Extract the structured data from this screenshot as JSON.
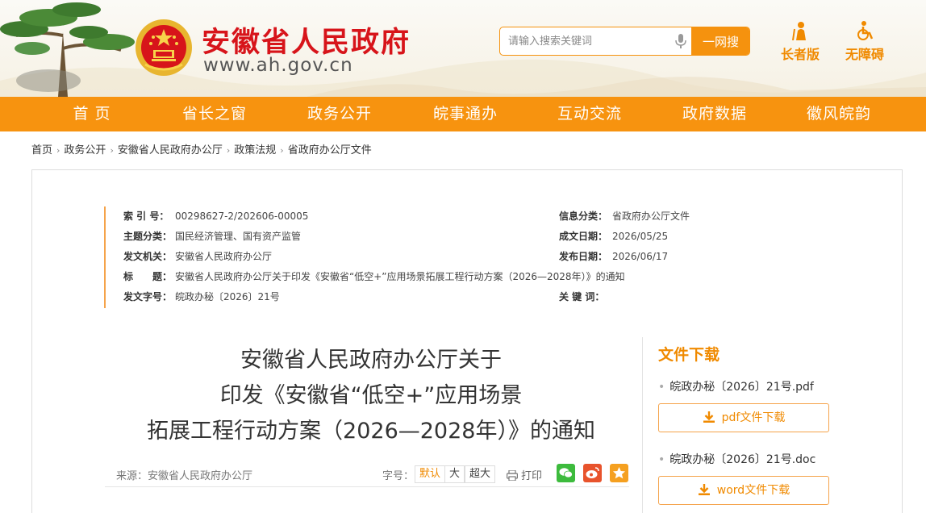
{
  "header": {
    "site_title": "安徽省人民政府",
    "site_url": "www.ah.gov.cn",
    "search": {
      "placeholder": "请输入搜索关键词",
      "button_label": "一网搜"
    },
    "tools": [
      {
        "label": "长者版",
        "icon": "elder-icon"
      },
      {
        "label": "无障碍",
        "icon": "wheelchair-icon"
      }
    ],
    "colors": {
      "brand_red": "#d7141a",
      "accent_orange": "#f7930f"
    }
  },
  "nav": {
    "items": [
      {
        "label": "首 页"
      },
      {
        "label": "省长之窗"
      },
      {
        "label": "政务公开"
      },
      {
        "label": "皖事通办"
      },
      {
        "label": "互动交流"
      },
      {
        "label": "政府数据"
      },
      {
        "label": "徽风皖韵"
      }
    ]
  },
  "breadcrumb": {
    "items": [
      "首页",
      "政务公开",
      "安徽省人民政府办公厅",
      "政策法规",
      "省政府办公厅文件"
    ]
  },
  "meta": {
    "index_no": {
      "key": "索 引 号：",
      "value": "00298627-2/202606-00005"
    },
    "theme": {
      "key": "主题分类：",
      "value": "国民经济管理、国有资产监管"
    },
    "issuer": {
      "key": "发文机关：",
      "value": "安徽省人民政府办公厅"
    },
    "title": {
      "key": "标　　题：",
      "value": "安徽省人民政府办公厅关于印发《安徽省“低空+”应用场景拓展工程行动方案（2026—2028年）》的通知"
    },
    "doc_no": {
      "key": "发文字号：",
      "value": "皖政办秘〔2026〕21号"
    },
    "info_class": {
      "key": "信息分类：",
      "value": "省政府办公厅文件"
    },
    "created": {
      "key": "成文日期：",
      "value": "2026/05/25"
    },
    "published": {
      "key": "发布日期：",
      "value": "2026/06/17"
    },
    "keywords": {
      "key": "关 键 词：",
      "value": ""
    }
  },
  "article": {
    "title_lines": [
      "安徽省人民政府办公厅关于",
      "印发《安徽省“低空+”应用场景",
      "拓展工程行动方案（2026—2028年）》的通知"
    ],
    "source": "来源：安徽省人民政府办公厅",
    "font_size_label": "字号：",
    "font_sizes": [
      "默认",
      "大",
      "超大"
    ],
    "print_label": "打印",
    "share_icons": [
      "wechat-icon",
      "weibo-icon",
      "favorite-icon"
    ]
  },
  "downloads": {
    "title": "文件下载",
    "files": [
      {
        "name": "皖政办秘〔2026〕21号.pdf",
        "button_label": "pdf文件下载"
      },
      {
        "name": "皖政办秘〔2026〕21号.doc",
        "button_label": "word文件下载"
      }
    ]
  }
}
